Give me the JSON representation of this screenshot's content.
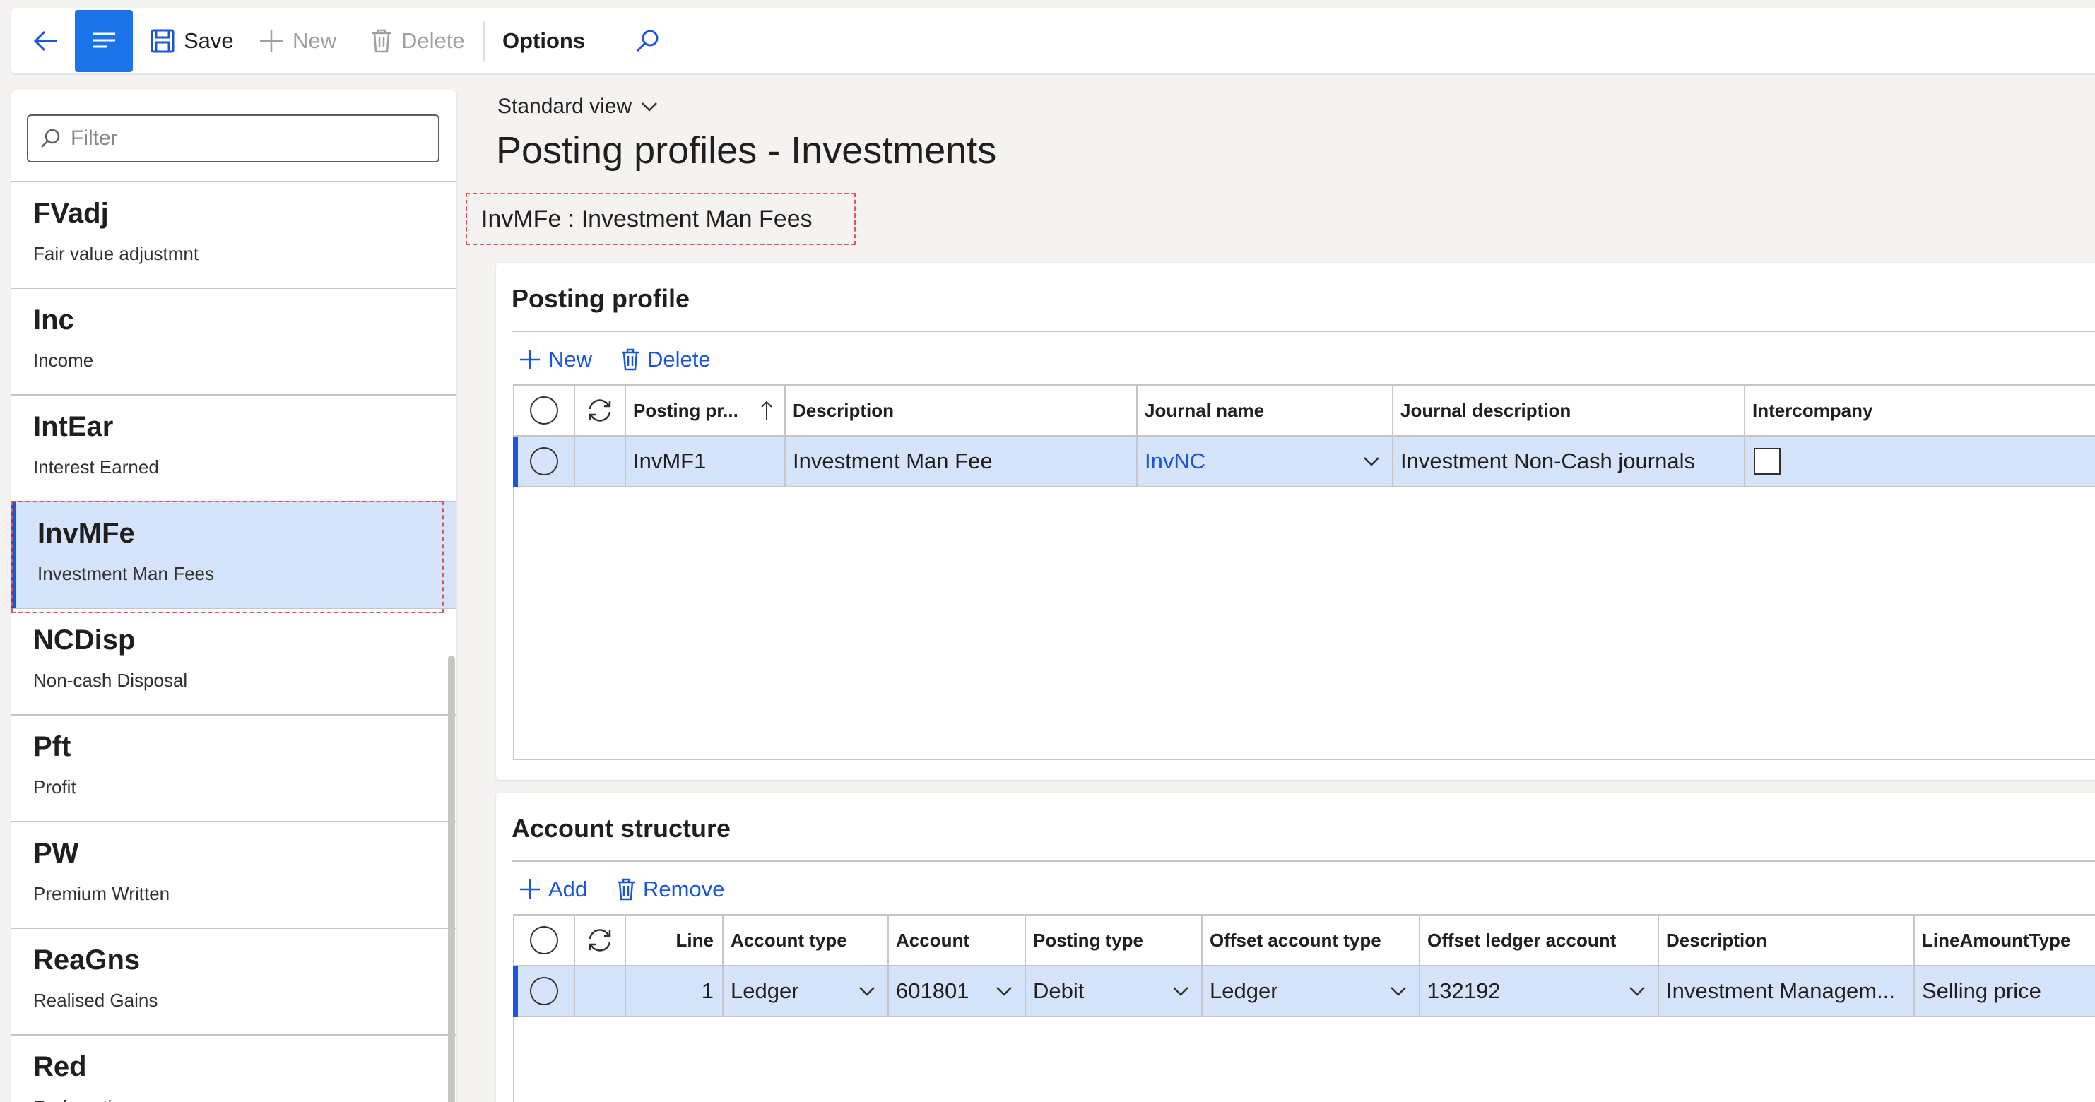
{
  "toolbar": {
    "save_label": "Save",
    "new_label": "New",
    "delete_label": "Delete",
    "options_label": "Options"
  },
  "filter": {
    "placeholder": "Filter"
  },
  "list": {
    "items": [
      {
        "code": "FVadj",
        "description": "Fair value adjustmnt"
      },
      {
        "code": "Inc",
        "description": "Income"
      },
      {
        "code": "IntEar",
        "description": "Interest Earned"
      },
      {
        "code": "InvMFe",
        "description": "Investment Man Fees",
        "selected": true
      },
      {
        "code": "NCDisp",
        "description": "Non-cash Disposal"
      },
      {
        "code": "Pft",
        "description": "Profit"
      },
      {
        "code": "PW",
        "description": "Premium Written"
      },
      {
        "code": "ReaGns",
        "description": "Realised Gains"
      },
      {
        "code": "Red",
        "description": "Redemption"
      }
    ]
  },
  "header": {
    "view_label": "Standard view",
    "page_title": "Posting profiles - Investments",
    "record_title": "InvMFe : Investment Man Fees"
  },
  "posting_profile": {
    "title": "Posting profile",
    "new_label": "New",
    "delete_label": "Delete",
    "columns": {
      "posting_profile": "Posting pr...",
      "description": "Description",
      "journal_name": "Journal name",
      "journal_description": "Journal description",
      "intercompany": "Intercompany"
    },
    "row": {
      "posting_profile": "InvMF1",
      "description": "Investment Man Fee",
      "journal_name": "InvNC",
      "journal_description": "Investment Non-Cash journals",
      "intercompany": false
    }
  },
  "account_structure": {
    "title": "Account structure",
    "add_label": "Add",
    "remove_label": "Remove",
    "columns": {
      "line": "Line",
      "account_type": "Account type",
      "account": "Account",
      "posting_type": "Posting type",
      "offset_account_type": "Offset account type",
      "offset_ledger_account": "Offset ledger account",
      "description": "Description",
      "line_amount_type": "LineAmountType"
    },
    "row": {
      "line": "1",
      "account_type": "Ledger",
      "account": "601801",
      "posting_type": "Debit",
      "offset_account_type": "Ledger",
      "offset_ledger_account": "132192",
      "description": "Investment Managem...",
      "line_amount_type": "Selling price"
    }
  },
  "colors": {
    "accent": "#1a73e8",
    "link": "#1a56db",
    "selected_row": "#d6e4fb",
    "highlight_border": "#e0525c"
  }
}
